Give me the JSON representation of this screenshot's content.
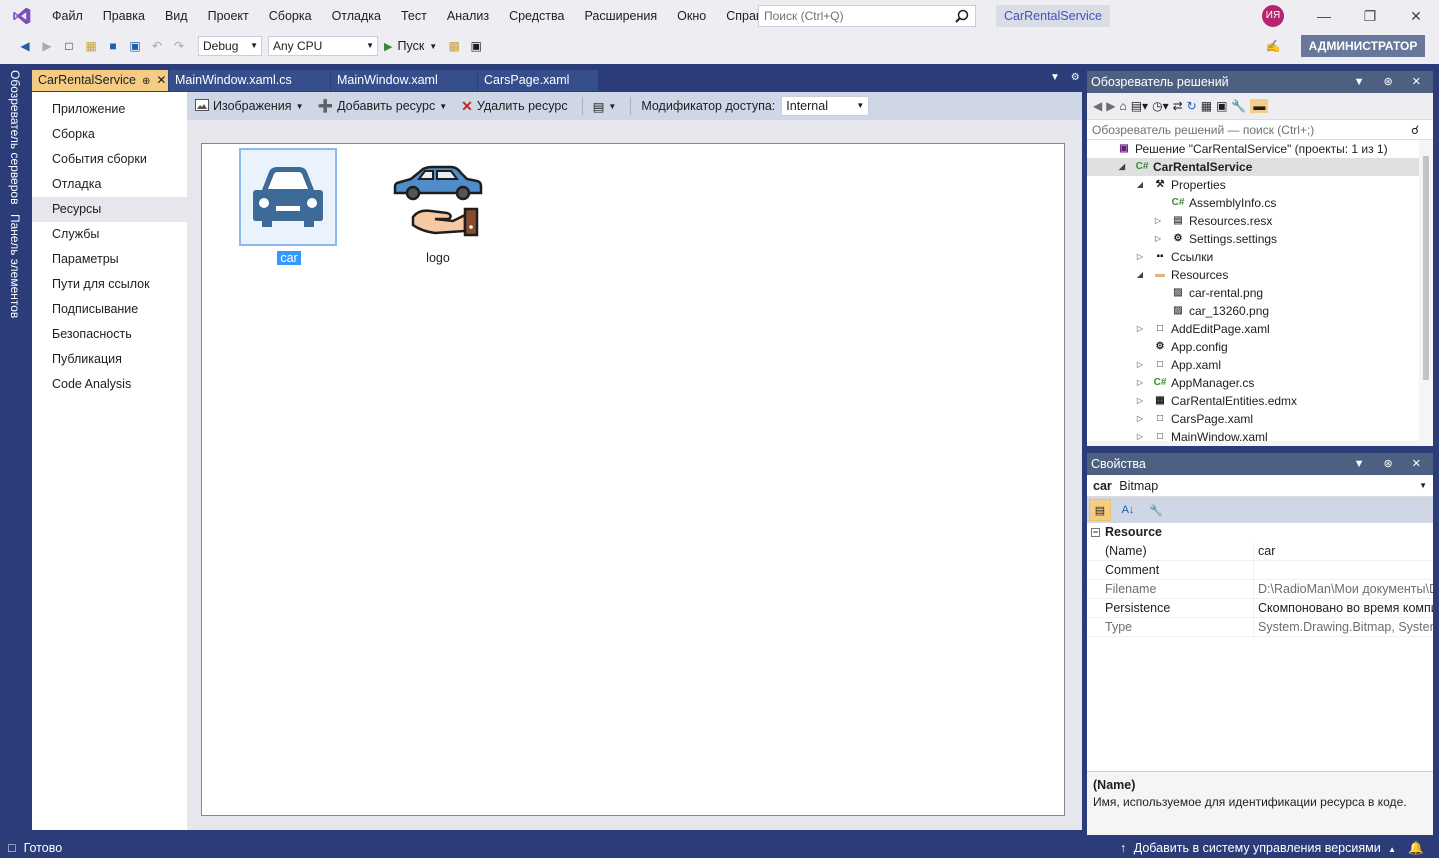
{
  "menu": [
    "Файл",
    "Правка",
    "Вид",
    "Проект",
    "Сборка",
    "Отладка",
    "Тест",
    "Анализ",
    "Средства",
    "Расширения",
    "Окно",
    "Справка"
  ],
  "search": {
    "placeholder": "Поиск (Ctrl+Q)"
  },
  "app_title": "CarRentalService",
  "user_initials": "ИЯ",
  "toolbar": {
    "configuration": "Debug",
    "platform": "Any CPU",
    "run_label": "Пуск",
    "admin_label": "АДМИНИСТРАТОР"
  },
  "side_tabs": [
    "Обозреватель серверов",
    "Панель элементов"
  ],
  "doc_tabs": [
    {
      "label": "CarRentalService",
      "active": true
    },
    {
      "label": "MainWindow.xaml.cs",
      "active": false
    },
    {
      "label": "MainWindow.xaml",
      "active": false
    },
    {
      "label": "CarsPage.xaml",
      "active": false
    }
  ],
  "nav": [
    "Приложение",
    "Сборка",
    "События сборки",
    "Отладка",
    "Ресурсы",
    "Службы",
    "Параметры",
    "Пути для ссылок",
    "Подписывание",
    "Безопасность",
    "Публикация",
    "Code Analysis"
  ],
  "nav_active": "Ресурсы",
  "res_toolbar": {
    "images": "Изображения",
    "add": "Добавить ресурс",
    "remove": "Удалить ресурс",
    "access_label": "Модификатор доступа:",
    "access_value": "Internal"
  },
  "resources": [
    {
      "name": "car",
      "selected": true
    },
    {
      "name": "logo",
      "selected": false
    }
  ],
  "solution_explorer": {
    "title": "Обозреватель решений",
    "search_placeholder": "Обозреватель решений — поиск (Ctrl+;)",
    "items": [
      {
        "label": "Решение \"CarRentalService\" (проекты: 1 из 1)",
        "level": 0,
        "icon": "solution-icon",
        "exp": ""
      },
      {
        "label": "CarRentalService",
        "level": 1,
        "icon": "csharp-project-icon",
        "exp": "open",
        "selected": true
      },
      {
        "label": "Properties",
        "level": 2,
        "icon": "wrench-icon",
        "exp": "open"
      },
      {
        "label": "AssemblyInfo.cs",
        "level": 3,
        "icon": "csharp-file-icon",
        "exp": ""
      },
      {
        "label": "Resources.resx",
        "level": 3,
        "icon": "resx-file-icon",
        "exp": "closed"
      },
      {
        "label": "Settings.settings",
        "level": 3,
        "icon": "settings-gear-icon",
        "exp": "closed"
      },
      {
        "label": "Ссылки",
        "level": 2,
        "icon": "references-icon",
        "exp": "closed"
      },
      {
        "label": "Resources",
        "level": 2,
        "icon": "folder-icon",
        "exp": "open"
      },
      {
        "label": "car-rental.png",
        "level": 3,
        "icon": "image-file-icon",
        "exp": ""
      },
      {
        "label": "car_13260.png",
        "level": 3,
        "icon": "image-file-icon",
        "exp": ""
      },
      {
        "label": "AddEditPage.xaml",
        "level": 2,
        "icon": "xaml-file-icon",
        "exp": "closed"
      },
      {
        "label": "App.config",
        "level": 2,
        "icon": "config-file-icon",
        "exp": ""
      },
      {
        "label": "App.xaml",
        "level": 2,
        "icon": "xaml-file-icon",
        "exp": "closed"
      },
      {
        "label": "AppManager.cs",
        "level": 2,
        "icon": "csharp-file-icon",
        "exp": "closed"
      },
      {
        "label": "CarRentalEntities.edmx",
        "level": 2,
        "icon": "edmx-file-icon",
        "exp": "closed"
      },
      {
        "label": "CarsPage.xaml",
        "level": 2,
        "icon": "xaml-file-icon",
        "exp": "closed"
      },
      {
        "label": "MainWindow.xaml",
        "level": 2,
        "icon": "xaml-file-icon",
        "exp": "closed"
      }
    ]
  },
  "properties": {
    "title": "Свойства",
    "object_name": "car",
    "object_type": "Bitmap",
    "category": "Resource",
    "rows": [
      {
        "name": "(Name)",
        "value": "car",
        "readonly": false
      },
      {
        "name": "Comment",
        "value": "",
        "readonly": false
      },
      {
        "name": "Filename",
        "value": "D:\\RadioMan\\Мои документы\\D",
        "readonly": true
      },
      {
        "name": "Persistence",
        "value": "Скомпоновано во время компи",
        "readonly": false
      },
      {
        "name": "Type",
        "value": "System.Drawing.Bitmap, System.",
        "readonly": true
      }
    ],
    "desc_title": "(Name)",
    "desc_text": "Имя, используемое для идентификации ресурса в коде."
  },
  "status": {
    "ready": "Готово",
    "vcs": "Добавить в систему управления версиями"
  },
  "colors": {
    "frame": "#2b3c78",
    "accent_tab": "#f5cc84",
    "car_blue": "#3d6a96",
    "title_accent": "#3b55c2"
  }
}
